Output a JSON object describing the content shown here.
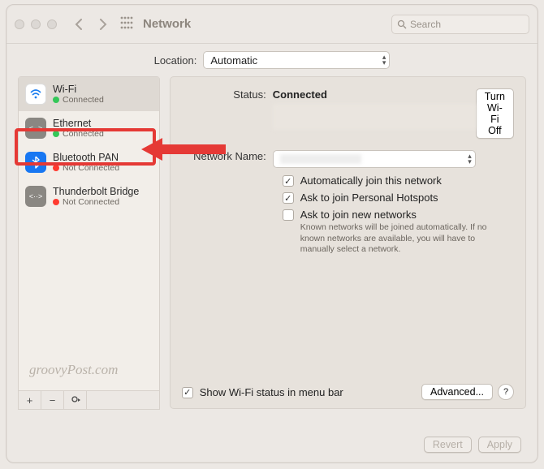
{
  "titlebar": {
    "title": "Network",
    "search_placeholder": "Search"
  },
  "location": {
    "label": "Location:",
    "value": "Automatic"
  },
  "sidebar": {
    "items": [
      {
        "name": "Wi-Fi",
        "status": "Connected",
        "dot": "green"
      },
      {
        "name": "Ethernet",
        "status": "Connected",
        "dot": "green"
      },
      {
        "name": "Bluetooth PAN",
        "status": "Not Connected",
        "dot": "red"
      },
      {
        "name": "Thunderbolt Bridge",
        "status": "Not Connected",
        "dot": "red"
      }
    ]
  },
  "content": {
    "status_label": "Status:",
    "status_value": "Connected",
    "turn_off_label": "Turn Wi-Fi Off",
    "network_name_label": "Network Name:",
    "auto_join": "Automatically join this network",
    "ask_hotspots": "Ask to join Personal Hotspots",
    "ask_new": "Ask to join new networks",
    "ask_new_help": "Known networks will be joined automatically. If no known networks are available, you will have to manually select a network.",
    "show_menubar": "Show Wi-Fi status in menu bar",
    "advanced": "Advanced...",
    "help": "?"
  },
  "footer": {
    "revert": "Revert",
    "apply": "Apply"
  },
  "watermark": "groovyPost.com"
}
